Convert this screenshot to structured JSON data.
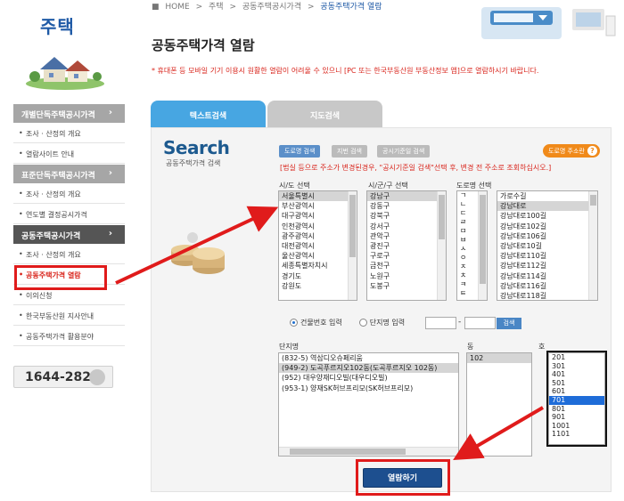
{
  "sidebar": {
    "title": "주택",
    "sections": [
      {
        "head": "개별단독주택공시가격",
        "items": [
          "조사 · 산정의 개요",
          "열람사이트 안내"
        ]
      },
      {
        "head": "표준단독주택공시가격",
        "items": [
          "조사 · 산정의 개요",
          "연도별 결정공시가격"
        ]
      },
      {
        "head": "공동주택공시가격",
        "items": [
          "조사 · 산정의 개요",
          "공동주택가격 열람",
          "이의신청",
          "한국부동산원 지사안내",
          "공동주택가격 활용분야"
        ]
      }
    ],
    "arrow": "›",
    "phone": "1644-2828"
  },
  "breadcrumb": {
    "home": "HOME",
    "sep": ">",
    "l1": "주택",
    "l2": "공동주택공시가격",
    "current": "공동주택가격 열람"
  },
  "page_title": "공동주택가격 열람",
  "notice": "* 휴대폰 등 모바일 기기 이용시 원활한 열람이 어려울 수 있으니 [PC 또는 한국부동산원 부동산정보 앱]으로 열람하시기 바랍니다.",
  "tabs": {
    "text_search": "텍스트검색",
    "map_search": "지도검색"
  },
  "search_logo": "Search",
  "search_sub": "공동주택가격 검색",
  "buttons": {
    "road": "도로명 검색",
    "jibun": "지번 검색",
    "notice_date": "공시기준일 검색",
    "help": "도로명 주소란",
    "help_q": "?",
    "search": "검색",
    "view": "열람하기"
  },
  "warning": "[법실 등으로 주소가 변경된경우, \"공시기준일 검색\"선택 후, 변경 전 주소로 조회하십시오.]",
  "labels": {
    "sido": "시/도 선택",
    "sigungu": "시/군/구 선택",
    "road": "도로명 선택",
    "danji": "단지명",
    "dong": "동",
    "ho": "호"
  },
  "sido_list": [
    "서울특별시",
    "부산광역시",
    "대구광역시",
    "인천광역시",
    "광주광역시",
    "대전광역시",
    "울산광역시",
    "세종특별자치시",
    "경기도",
    "강원도"
  ],
  "sigungu_list": [
    "강남구",
    "강동구",
    "강북구",
    "강서구",
    "관악구",
    "광진구",
    "구로구",
    "금천구",
    "노원구",
    "도봉구"
  ],
  "initial_list": [
    "ㄱ",
    "ㄴ",
    "ㄷ",
    "ㄹ",
    "ㅁ",
    "ㅂ",
    "ㅅ",
    "ㅇ",
    "ㅈ",
    "ㅊ",
    "ㅋ",
    "ㅌ"
  ],
  "road_list": [
    "가로수길",
    "강남대로",
    "강남대로100길",
    "강남대로102길",
    "강남대로106길",
    "강남대로10길",
    "강남대로110길",
    "강남대로112길",
    "강남대로114길",
    "강남대로116길",
    "강남대로118길"
  ],
  "radio": {
    "building_no": "건물번호 입력",
    "danji_name": "단지명 입력"
  },
  "danji_list": [
    "(832-5) 역삼디오슈페리움",
    "(949-2) 도곡푸르지오102동(도곡푸르지오 102동)",
    "(952) 대우양재디오빌(대우디오빌)",
    "(953-1) 양재SK허브프리모(SK허브프리모)"
  ],
  "dong_list": [
    "102"
  ],
  "ho_list": [
    "201",
    "301",
    "401",
    "501",
    "601",
    "701",
    "801",
    "901",
    "1001",
    "1101"
  ]
}
